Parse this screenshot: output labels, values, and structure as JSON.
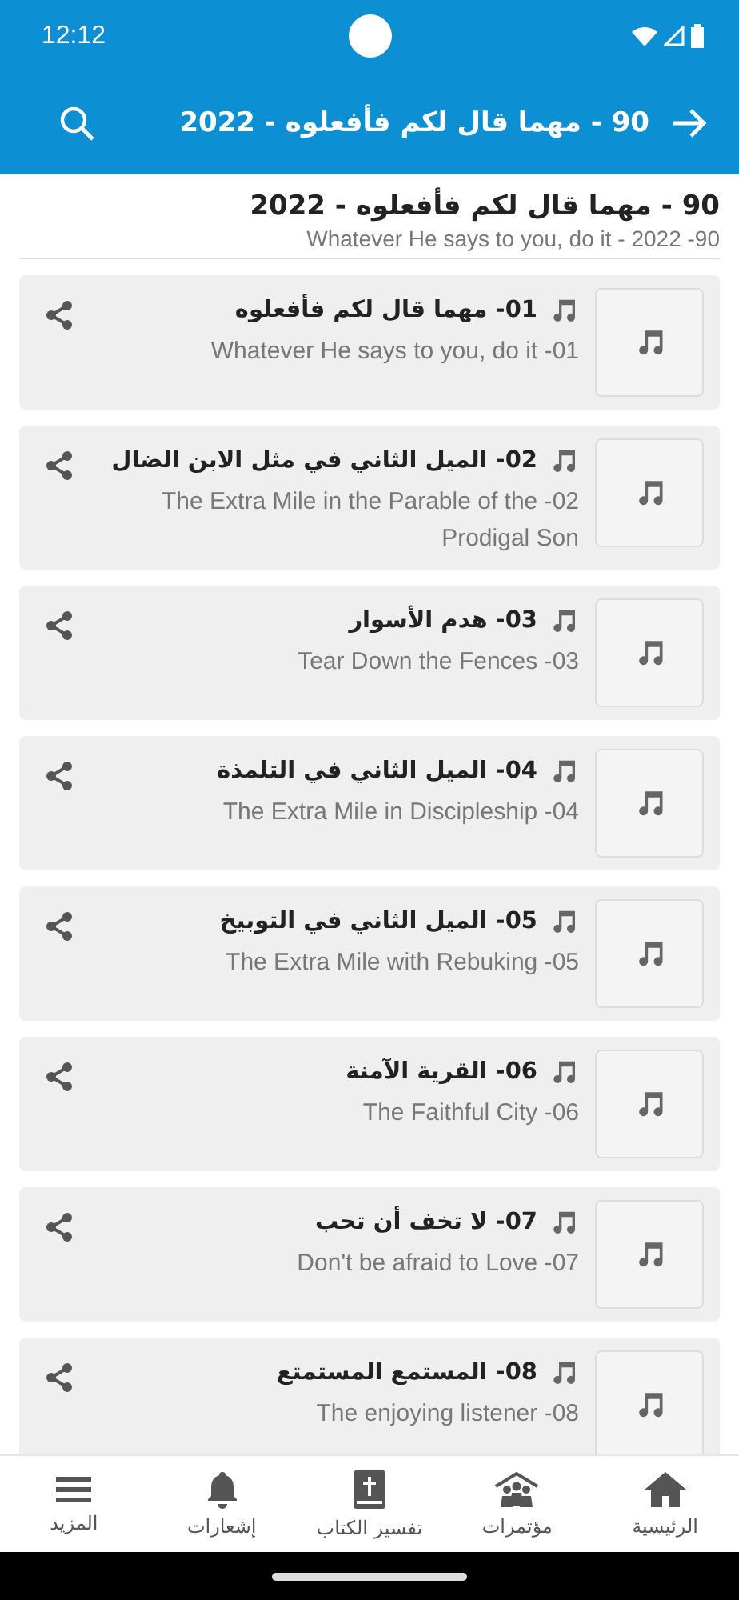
{
  "status_bar": {
    "time": "12:12"
  },
  "app_bar": {
    "title": "90 - مهما قال لكم فأفعلوه - 2022"
  },
  "header": {
    "title": "90 - مهما قال لكم فأفعلوه - 2022",
    "subtitle": "90- Whatever He says to you, do it - 2022"
  },
  "tracks": [
    {
      "title": "01- مهما قال لكم فأفعلوه",
      "subtitle": "01- Whatever He says to you, do it"
    },
    {
      "title": "02- الميل الثاني في مثل الابن الضال",
      "subtitle": "02- The Extra Mile in the Parable of the Prodigal Son"
    },
    {
      "title": "03- هدم الأسوار",
      "subtitle": "03- Tear Down the Fences"
    },
    {
      "title": "04- الميل الثاني في التلمذة",
      "subtitle": "04- The Extra Mile in Discipleship"
    },
    {
      "title": "05- الميل الثاني في التوبيخ",
      "subtitle": "05- The Extra Mile with Rebuking"
    },
    {
      "title": "06- القرية الآمنة",
      "subtitle": "06- The Faithful City"
    },
    {
      "title": "07- لا تخف أن تحب",
      "subtitle": "07- Don't be afraid to Love"
    },
    {
      "title": "08- المستمع المستمتع",
      "subtitle": "08- The enjoying listener"
    }
  ],
  "bottom_nav": [
    {
      "label": "الرئيسية",
      "kind": "home"
    },
    {
      "label": "مؤتمرات",
      "kind": "people"
    },
    {
      "label": "تفسير الكتاب",
      "kind": "book"
    },
    {
      "label": "إشعارات",
      "kind": "bell"
    },
    {
      "label": "المزيد",
      "kind": "menu"
    }
  ]
}
